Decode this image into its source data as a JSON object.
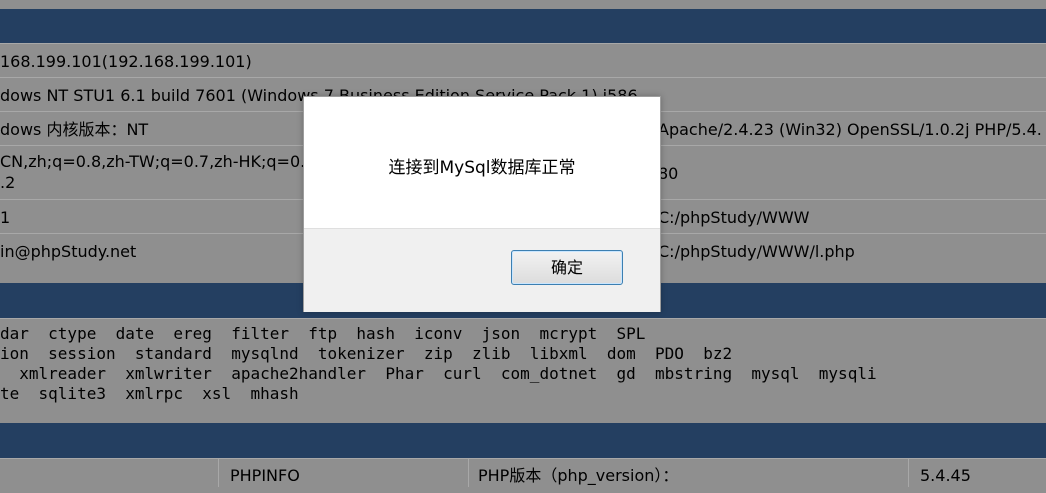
{
  "info_rows": [
    {
      "left": "168.199.101(192.168.199.101)",
      "right": ""
    },
    {
      "left": "dows NT STU1 6.1 build 7601 (Windows 7 Business Edition Service Pack 1) i586",
      "right": ""
    },
    {
      "left": "dows  内核版本：NT",
      "right": "Apache/2.4.23 (Win32) OpenSSL/1.0.2j PHP/5.4."
    },
    {
      "left_line1": "CN,zh;q=0.8,zh-TW;q=0.7,zh-HK;q=0.",
      "left_line2": ".2",
      "right": "80"
    },
    {
      "left": "1",
      "right": "C:/phpStudy/WWW"
    },
    {
      "left": "in@phpStudy.net",
      "right": "C:/phpStudy/WWW/l.php"
    }
  ],
  "extensions": [
    "dar  ctype  date  ereg  filter  ftp  hash  iconv  json  mcrypt  SPL",
    "ion  session  standard  mysqlnd  tokenizer  zip  zlib  libxml  dom  PDO  bz2",
    "  xmlreader  xmlwriter  apache2handler  Phar  curl  com_dotnet  gd  mbstring  mysql  mysqli",
    "te  sqlite3  xmlrpc  xsl  mhash"
  ],
  "bottom_row": {
    "phpinfo": "PHPINFO",
    "php_version_label": "PHP版本（php_version）：",
    "php_version_value": "5.4.45"
  },
  "dialog": {
    "message": "连接到MySql数据库正常",
    "ok_label": "确定"
  }
}
